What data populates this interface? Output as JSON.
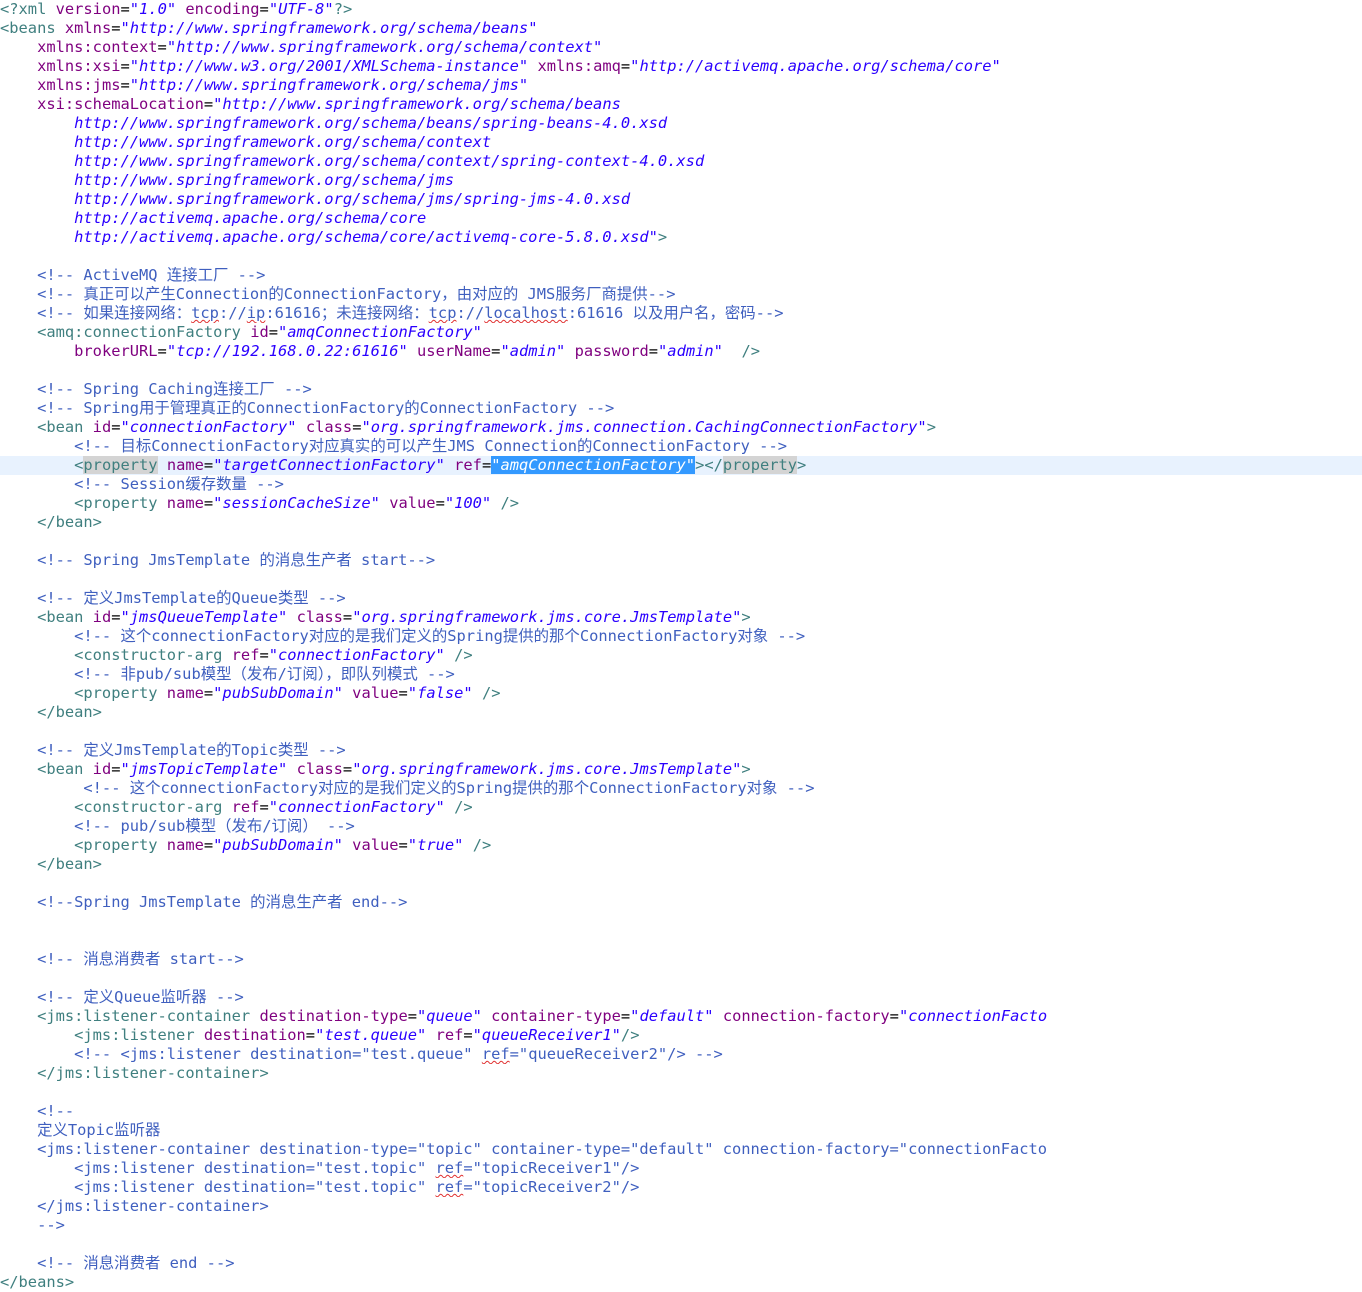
{
  "editor": {
    "title": "XML source editor",
    "lines": [
      [
        [
          "tag",
          "<?xml "
        ],
        [
          "attr",
          "version"
        ],
        [
          "txt",
          "="
        ],
        [
          "val",
          "\"1.0\""
        ],
        [
          "txt",
          " "
        ],
        [
          "attr",
          "encoding"
        ],
        [
          "txt",
          "="
        ],
        [
          "val",
          "\"UTF-8\""
        ],
        [
          "tag",
          "?>"
        ]
      ],
      [
        [
          "tag",
          "<beans "
        ],
        [
          "attr",
          "xmlns"
        ],
        [
          "txt",
          "="
        ],
        [
          "val",
          "\"http://www.springframework.org/schema/beans\""
        ]
      ],
      [
        [
          "txt",
          "    "
        ],
        [
          "attr",
          "xmlns:context"
        ],
        [
          "txt",
          "="
        ],
        [
          "val",
          "\"http://www.springframework.org/schema/context\""
        ]
      ],
      [
        [
          "txt",
          "    "
        ],
        [
          "attr",
          "xmlns:xsi"
        ],
        [
          "txt",
          "="
        ],
        [
          "val",
          "\"http://www.w3.org/2001/XMLSchema-instance\""
        ],
        [
          "txt",
          " "
        ],
        [
          "attr",
          "xmlns:amq"
        ],
        [
          "txt",
          "="
        ],
        [
          "val",
          "\"http://activemq.apache.org/schema/core\""
        ]
      ],
      [
        [
          "txt",
          "    "
        ],
        [
          "attr",
          "xmlns:jms"
        ],
        [
          "txt",
          "="
        ],
        [
          "val",
          "\"http://www.springframework.org/schema/jms\""
        ]
      ],
      [
        [
          "txt",
          "    "
        ],
        [
          "attr",
          "xsi:schemaLocation"
        ],
        [
          "txt",
          "="
        ],
        [
          "val",
          "\"http://www.springframework.org/schema/beans"
        ]
      ],
      [
        [
          "val",
          "        http://www.springframework.org/schema/beans/spring-beans-4.0.xsd"
        ]
      ],
      [
        [
          "val",
          "        http://www.springframework.org/schema/context"
        ]
      ],
      [
        [
          "val",
          "        http://www.springframework.org/schema/context/spring-context-4.0.xsd"
        ]
      ],
      [
        [
          "val",
          "        http://www.springframework.org/schema/jms"
        ]
      ],
      [
        [
          "val",
          "        http://www.springframework.org/schema/jms/spring-jms-4.0.xsd"
        ]
      ],
      [
        [
          "val",
          "        http://activemq.apache.org/schema/core"
        ]
      ],
      [
        [
          "val",
          "        http://activemq.apache.org/schema/core/activemq-core-5.8.0.xsd\""
        ],
        [
          "tag",
          ">"
        ]
      ],
      [],
      [
        [
          "com",
          "    <!-- ActiveMQ 连接工厂 -->"
        ]
      ],
      [
        [
          "com",
          "    <!-- 真正可以产生Connection的ConnectionFactory，由对应的 JMS服务厂商提供-->"
        ]
      ],
      [
        [
          "com",
          "    <!-- 如果连接网络："
        ],
        [
          "com sq",
          "tcp"
        ],
        [
          "com",
          "://"
        ],
        [
          "com sq",
          "ip"
        ],
        [
          "com",
          ":61616；未连接网络："
        ],
        [
          "com sq",
          "tcp"
        ],
        [
          "com",
          "://"
        ],
        [
          "com sq",
          "localhost"
        ],
        [
          "com",
          ":61616 以及用户名，密码-->"
        ]
      ],
      [
        [
          "tag",
          "    <amq:connectionFactory "
        ],
        [
          "attr",
          "id"
        ],
        [
          "txt",
          "="
        ],
        [
          "val",
          "\"amqConnectionFactory\""
        ]
      ],
      [
        [
          "txt",
          "        "
        ],
        [
          "attr",
          "brokerURL"
        ],
        [
          "txt",
          "="
        ],
        [
          "val",
          "\"tcp://192.168.0.22:61616\""
        ],
        [
          "txt",
          " "
        ],
        [
          "attr",
          "userName"
        ],
        [
          "txt",
          "="
        ],
        [
          "val",
          "\"admin\""
        ],
        [
          "txt",
          " "
        ],
        [
          "attr",
          "password"
        ],
        [
          "txt",
          "="
        ],
        [
          "val",
          "\"admin\""
        ],
        [
          "txt",
          "  "
        ],
        [
          "tag",
          "/>"
        ]
      ],
      [],
      [
        [
          "com",
          "    <!-- Spring Caching连接工厂 -->"
        ]
      ],
      [
        [
          "com",
          "    <!-- Spring用于管理真正的ConnectionFactory的ConnectionFactory -->"
        ]
      ],
      [
        [
          "tag",
          "    <bean "
        ],
        [
          "attr",
          "id"
        ],
        [
          "txt",
          "="
        ],
        [
          "val",
          "\"connectionFactory\""
        ],
        [
          "txt",
          " "
        ],
        [
          "attr",
          "class"
        ],
        [
          "txt",
          "="
        ],
        [
          "val",
          "\"org.springframework.jms.connection.CachingConnectionFactory\""
        ],
        [
          "tag",
          ">"
        ]
      ],
      [
        [
          "com",
          "        <!-- 目标ConnectionFactory对应真实的可以产生JMS Connection的ConnectionFactory -->"
        ]
      ],
      [
        [
          "tag",
          "        <"
        ],
        [
          "tag mark",
          "property"
        ],
        [
          "tag",
          " "
        ],
        [
          "attr",
          "name"
        ],
        [
          "txt",
          "="
        ],
        [
          "val",
          "\"targetConnectionFactory\""
        ],
        [
          "txt",
          " "
        ],
        [
          "attr",
          "ref"
        ],
        [
          "txt",
          "="
        ],
        [
          "val sel",
          "\"amqConnectionFactory\""
        ],
        [
          "tag",
          "></"
        ],
        [
          "tag mark",
          "property"
        ],
        [
          "tag",
          ">"
        ]
      ],
      [
        [
          "com",
          "        <!-- Session缓存数量 -->"
        ]
      ],
      [
        [
          "tag",
          "        <property "
        ],
        [
          "attr",
          "name"
        ],
        [
          "txt",
          "="
        ],
        [
          "val",
          "\"sessionCacheSize\""
        ],
        [
          "txt",
          " "
        ],
        [
          "attr",
          "value"
        ],
        [
          "txt",
          "="
        ],
        [
          "val",
          "\"100\""
        ],
        [
          "txt",
          " "
        ],
        [
          "tag",
          "/>"
        ]
      ],
      [
        [
          "tag",
          "    </bean>"
        ]
      ],
      [],
      [
        [
          "com",
          "    <!-- Spring JmsTemplate 的消息生产者 start-->"
        ]
      ],
      [],
      [
        [
          "com",
          "    <!-- 定义JmsTemplate的Queue类型 -->"
        ]
      ],
      [
        [
          "tag",
          "    <bean "
        ],
        [
          "attr",
          "id"
        ],
        [
          "txt",
          "="
        ],
        [
          "val",
          "\"jmsQueueTemplate\""
        ],
        [
          "txt",
          " "
        ],
        [
          "attr",
          "class"
        ],
        [
          "txt",
          "="
        ],
        [
          "val",
          "\"org.springframework.jms.core.JmsTemplate\""
        ],
        [
          "tag",
          ">"
        ]
      ],
      [
        [
          "com",
          "        <!-- 这个connectionFactory对应的是我们定义的Spring提供的那个ConnectionFactory对象 -->"
        ]
      ],
      [
        [
          "tag",
          "        <constructor-arg "
        ],
        [
          "attr",
          "ref"
        ],
        [
          "txt",
          "="
        ],
        [
          "val",
          "\"connectionFactory\""
        ],
        [
          "txt",
          " "
        ],
        [
          "tag",
          "/>"
        ]
      ],
      [
        [
          "com",
          "        <!-- 非pub/sub模型（发布/订阅），即队列模式 -->"
        ]
      ],
      [
        [
          "tag",
          "        <property "
        ],
        [
          "attr",
          "name"
        ],
        [
          "txt",
          "="
        ],
        [
          "val",
          "\"pubSubDomain\""
        ],
        [
          "txt",
          " "
        ],
        [
          "attr",
          "value"
        ],
        [
          "txt",
          "="
        ],
        [
          "val",
          "\"false\""
        ],
        [
          "txt",
          " "
        ],
        [
          "tag",
          "/>"
        ]
      ],
      [
        [
          "tag",
          "    </bean>"
        ]
      ],
      [],
      [
        [
          "com",
          "    <!-- 定义JmsTemplate的Topic类型 -->"
        ]
      ],
      [
        [
          "tag",
          "    <bean "
        ],
        [
          "attr",
          "id"
        ],
        [
          "txt",
          "="
        ],
        [
          "val",
          "\"jmsTopicTemplate\""
        ],
        [
          "txt",
          " "
        ],
        [
          "attr",
          "class"
        ],
        [
          "txt",
          "="
        ],
        [
          "val",
          "\"org.springframework.jms.core.JmsTemplate\""
        ],
        [
          "tag",
          ">"
        ]
      ],
      [
        [
          "com",
          "         <!-- 这个connectionFactory对应的是我们定义的Spring提供的那个ConnectionFactory对象 -->"
        ]
      ],
      [
        [
          "tag",
          "        <constructor-arg "
        ],
        [
          "attr",
          "ref"
        ],
        [
          "txt",
          "="
        ],
        [
          "val",
          "\"connectionFactory\""
        ],
        [
          "txt",
          " "
        ],
        [
          "tag",
          "/>"
        ]
      ],
      [
        [
          "com",
          "        <!-- pub/sub模型（发布/订阅） -->"
        ]
      ],
      [
        [
          "tag",
          "        <property "
        ],
        [
          "attr",
          "name"
        ],
        [
          "txt",
          "="
        ],
        [
          "val",
          "\"pubSubDomain\""
        ],
        [
          "txt",
          " "
        ],
        [
          "attr",
          "value"
        ],
        [
          "txt",
          "="
        ],
        [
          "val",
          "\"true\""
        ],
        [
          "txt",
          " "
        ],
        [
          "tag",
          "/>"
        ]
      ],
      [
        [
          "tag",
          "    </bean>"
        ]
      ],
      [],
      [
        [
          "com",
          "    <!--Spring JmsTemplate 的消息生产者 end-->"
        ]
      ],
      [],
      [],
      [
        [
          "com",
          "    <!-- 消息消费者 start-->"
        ]
      ],
      [],
      [
        [
          "com",
          "    <!-- 定义Queue监听器 -->"
        ]
      ],
      [
        [
          "tag",
          "    <jms:listener-container "
        ],
        [
          "attr",
          "destination-type"
        ],
        [
          "txt",
          "="
        ],
        [
          "val",
          "\"queue\""
        ],
        [
          "txt",
          " "
        ],
        [
          "attr",
          "container-type"
        ],
        [
          "txt",
          "="
        ],
        [
          "val",
          "\"default\""
        ],
        [
          "txt",
          " "
        ],
        [
          "attr",
          "connection-factory"
        ],
        [
          "txt",
          "="
        ],
        [
          "val",
          "\"connectionFacto"
        ]
      ],
      [
        [
          "tag",
          "        <jms:listener "
        ],
        [
          "attr",
          "destination"
        ],
        [
          "txt",
          "="
        ],
        [
          "val",
          "\"test.queue\""
        ],
        [
          "txt",
          " "
        ],
        [
          "attr",
          "ref"
        ],
        [
          "txt",
          "="
        ],
        [
          "val",
          "\"queueReceiver1\""
        ],
        [
          "tag",
          "/>"
        ]
      ],
      [
        [
          "com",
          "        <!-- <jms:listener destination=\"test.queue\" "
        ],
        [
          "com sq",
          "ref"
        ],
        [
          "com",
          "=\"queueReceiver2\"/> -->"
        ]
      ],
      [
        [
          "tag",
          "    </jms:listener-container>"
        ]
      ],
      [],
      [
        [
          "com",
          "    <!--"
        ]
      ],
      [
        [
          "com",
          "    定义Topic监听器"
        ]
      ],
      [
        [
          "com",
          "    <jms:listener-container destination-type=\"topic\" container-type=\"default\" connection-factory=\"connectionFacto"
        ]
      ],
      [
        [
          "com",
          "        <jms:listener destination=\"test.topic\" "
        ],
        [
          "com sq",
          "ref"
        ],
        [
          "com",
          "=\"topicReceiver1\"/>"
        ]
      ],
      [
        [
          "com",
          "        <jms:listener destination=\"test.topic\" "
        ],
        [
          "com sq",
          "ref"
        ],
        [
          "com",
          "=\"topicReceiver2\"/>"
        ]
      ],
      [
        [
          "com",
          "    </jms:listener-container>"
        ]
      ],
      [
        [
          "com",
          "    -->"
        ]
      ],
      [],
      [
        [
          "com",
          "    <!-- 消息消费者 end -->"
        ]
      ],
      [
        [
          "tag",
          "</beans>"
        ]
      ]
    ]
  }
}
